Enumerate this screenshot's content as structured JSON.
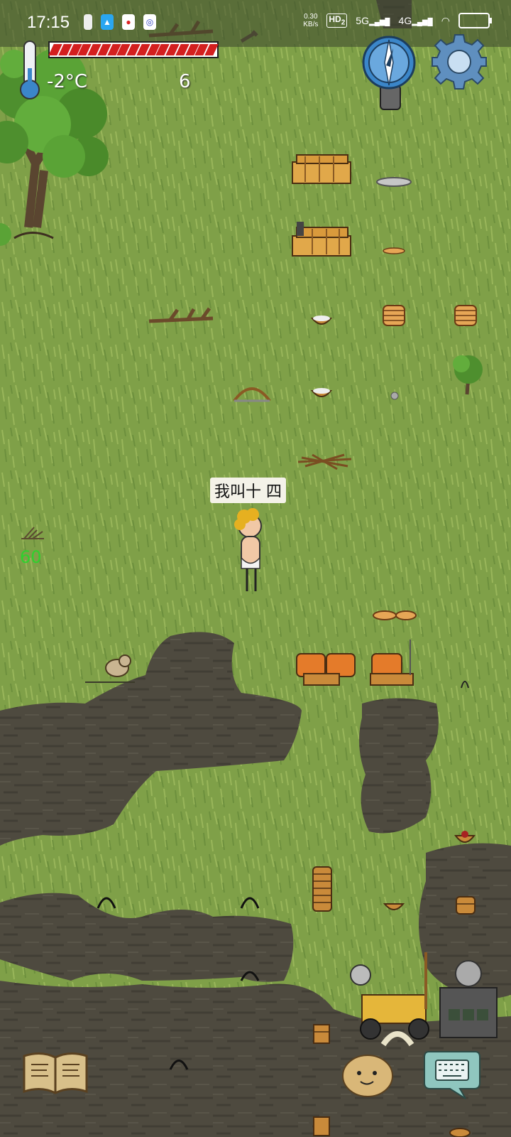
{
  "status_bar": {
    "time": "17:15",
    "net_rate_value": "0.30",
    "net_rate_unit": "KB/s",
    "hd_label": "HD",
    "hd_sub": "2",
    "sim1": "5G",
    "sim2": "4G"
  },
  "hud": {
    "temperature": "-2°C",
    "age": "6",
    "food_pips": 17,
    "fps": "60"
  },
  "player": {
    "speech": "我叫十 四"
  },
  "colors": {
    "grass": "#7fa048",
    "food_bar": "#d31f1f",
    "fps_text": "#2ed12e",
    "compass": "#3b86c9"
  },
  "icons": {
    "thermometer": "thermometer-icon",
    "compass": "compass-icon",
    "settings": "gear-icon",
    "recipe_book": "book-icon",
    "emote": "potato-face-icon",
    "chat": "keyboard-bubble-icon"
  }
}
